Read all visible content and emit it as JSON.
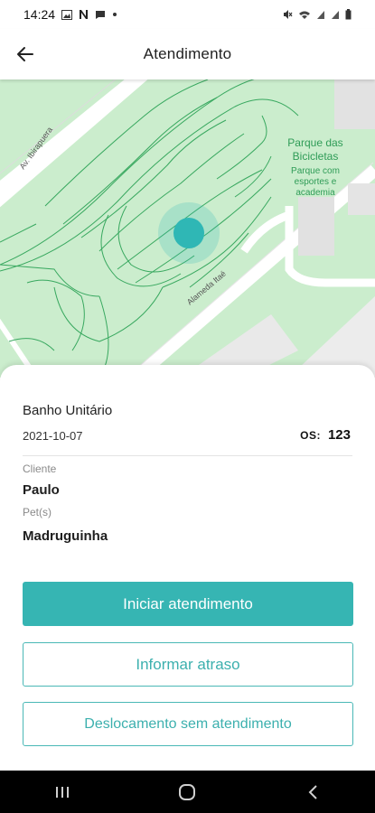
{
  "status_bar": {
    "time": "14:24",
    "icons": [
      "image-icon",
      "n-icon",
      "chat-icon",
      "dot-icon"
    ],
    "right_icons": [
      "mute-icon",
      "wifi-icon",
      "signal-icon",
      "signal-icon",
      "battery-icon"
    ]
  },
  "header": {
    "title": "Atendimento",
    "back_icon": "arrow-left-icon"
  },
  "map": {
    "street_1": "Av. Ibirapuera",
    "street_2": "Alameda Itaé",
    "poi_name_line1": "Parque das",
    "poi_name_line2": "Bicicletas",
    "poi_desc_line1": "Parque com",
    "poi_desc_line2": "esportes e",
    "poi_desc_line3": "academia",
    "marker_color": "#2fb7b5"
  },
  "appointment": {
    "service": "Banho Unitário",
    "date": "2021-10-07",
    "os_label": "OS:",
    "os_number": "123",
    "client_label": "Cliente",
    "client_name": "Paulo",
    "pets_label": "Pet(s)",
    "pets_value": "Madruguinha"
  },
  "actions": {
    "start": "Iniciar atendimento",
    "delay": "Informar atraso",
    "displacement": "Deslocamento sem atendimento"
  },
  "colors": {
    "accent": "#36b5b3",
    "map_green": "#cdeecf",
    "map_lines": "#36a85c"
  },
  "nav_bar": {
    "recents_icon": "recents-icon",
    "home_icon": "home-icon",
    "back_icon": "back-chevron-icon"
  }
}
